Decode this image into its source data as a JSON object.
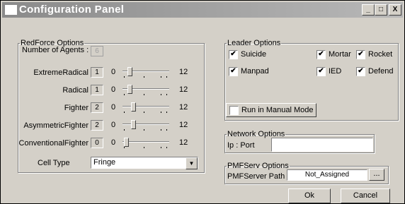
{
  "window": {
    "title": "Configuration Panel",
    "minimize": "_",
    "maximize": "□",
    "close": "X"
  },
  "redforce": {
    "legend": "RedForce Options",
    "num_agents_label": "Number of Agents :",
    "num_agents_value": "6",
    "rows": [
      {
        "label": "ExtremeRadical",
        "value": "1",
        "min": "0",
        "max": "12",
        "level": 0.08
      },
      {
        "label": "Radical",
        "value": "1",
        "min": "0",
        "max": "12",
        "level": 0.08
      },
      {
        "label": "Fighter",
        "value": "2",
        "min": "0",
        "max": "12",
        "level": 0.17
      },
      {
        "label": "AsymmetricFighter",
        "value": "2",
        "min": "0",
        "max": "12",
        "level": 0.17
      },
      {
        "label": "ConventionalFighter",
        "value": "0",
        "min": "0",
        "max": "12",
        "level": 0.0
      }
    ],
    "cell_type_label": "Cell Type",
    "cell_type_value": "Fringe"
  },
  "leader": {
    "legend": "Leader Options",
    "options": [
      {
        "label": "Suicide",
        "checked": true
      },
      {
        "label": "Mortar",
        "checked": true
      },
      {
        "label": "Rocket",
        "checked": true
      },
      {
        "label": "Manpad",
        "checked": true
      },
      {
        "label": "IED",
        "checked": true
      },
      {
        "label": "Defend",
        "checked": true
      }
    ],
    "manual_label": "Run in Manual Mode",
    "manual_checked": false
  },
  "network": {
    "legend": "Network Options",
    "ip_label": "Ip : Port",
    "ip_value": ""
  },
  "pmf": {
    "legend": "PMFServ Options",
    "path_label": "PMFServer Path",
    "path_value": "Not_Assigned",
    "browse_label": "..."
  },
  "buttons": {
    "ok": "Ok",
    "cancel": "Cancel"
  }
}
